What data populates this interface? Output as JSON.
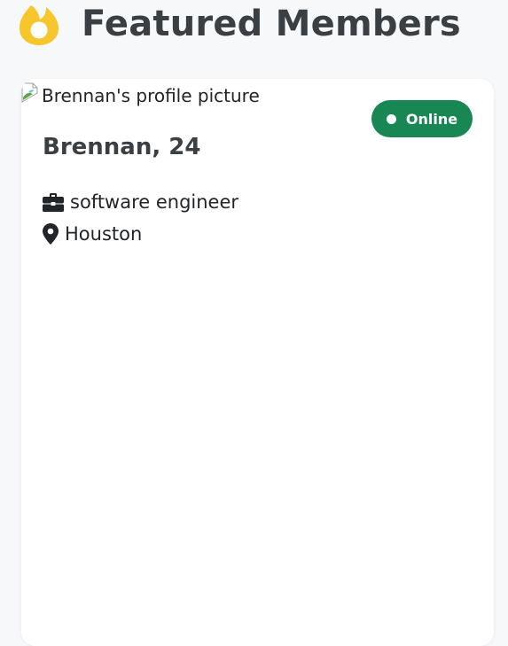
{
  "header": {
    "title": "Featured Members",
    "icon": "flame-icon",
    "icon_color": "#f7c62d"
  },
  "member": {
    "picture_alt": "Brennan's profile picture",
    "status": "Online",
    "status_color": "#198754",
    "name_age": "Brennan, 24",
    "occupation": "software engineer",
    "occupation_icon": "briefcase-icon",
    "location": "Houston",
    "location_icon": "location-pin-icon"
  }
}
